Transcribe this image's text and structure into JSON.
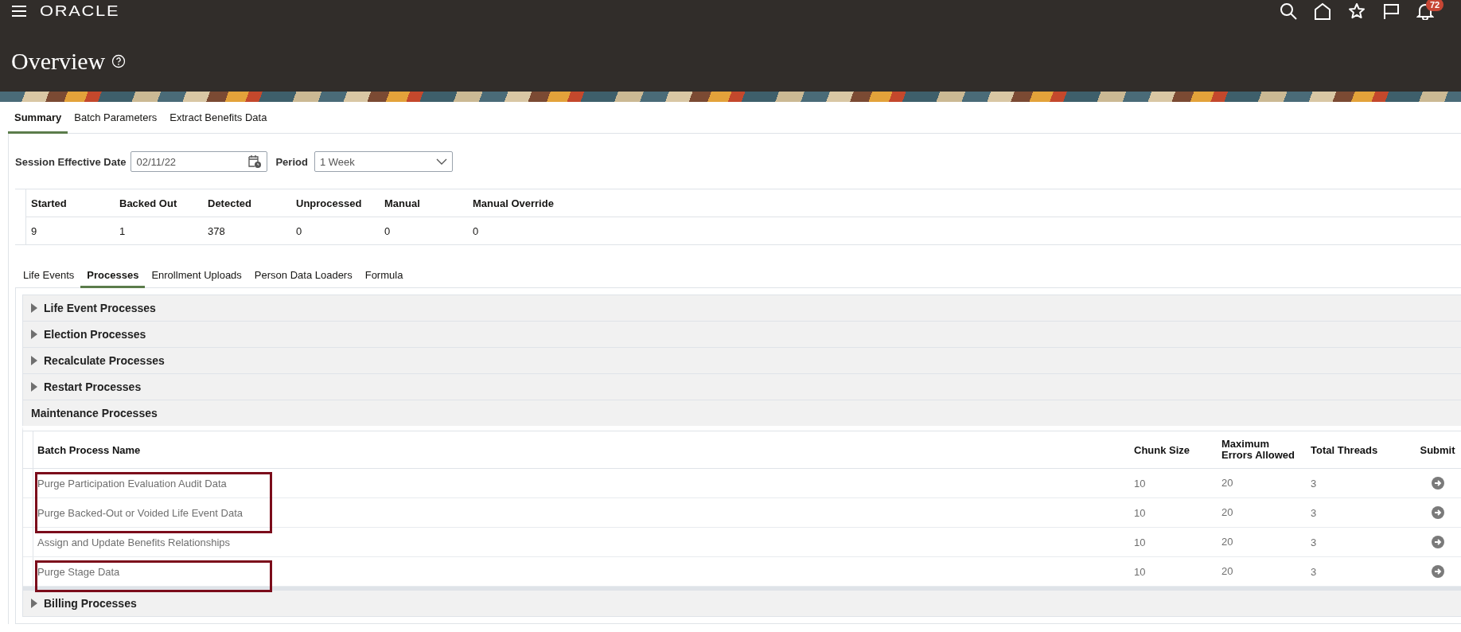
{
  "header": {
    "logo": "ORACLE",
    "notification_count": "72",
    "title": "Overview"
  },
  "tabs": [
    {
      "label": "Summary",
      "selected": true
    },
    {
      "label": "Batch Parameters",
      "selected": false
    },
    {
      "label": "Extract Benefits Data",
      "selected": false
    }
  ],
  "session": {
    "date_label": "Session Effective Date",
    "date_value": "02/11/22",
    "period_label": "Period",
    "period_value": "1 Week"
  },
  "summary": {
    "columns": [
      "Started",
      "Backed Out",
      "Detected",
      "Unprocessed",
      "Manual",
      "Manual Override"
    ],
    "values": [
      "9",
      "1",
      "378",
      "0",
      "0",
      "0"
    ]
  },
  "sub_tabs": [
    {
      "label": "Life Events",
      "selected": false
    },
    {
      "label": "Processes",
      "selected": true
    },
    {
      "label": "Enrollment Uploads",
      "selected": false
    },
    {
      "label": "Person Data Loaders",
      "selected": false
    },
    {
      "label": "Formula",
      "selected": false
    }
  ],
  "process_groups": [
    {
      "title": "Life Event Processes",
      "expanded": false
    },
    {
      "title": "Election Processes",
      "expanded": false
    },
    {
      "title": "Recalculate Processes",
      "expanded": false
    },
    {
      "title": "Restart Processes",
      "expanded": false
    },
    {
      "title": "Maintenance Processes",
      "expanded": true,
      "table": {
        "columns": [
          "Batch Process Name",
          "Chunk Size",
          "Maximum Errors Allowed",
          "Total Threads",
          "Submit"
        ],
        "rows": [
          {
            "name": "Purge Participation Evaluation Audit Data",
            "chunk_size": "10",
            "max_errors": "20",
            "total_threads": "3",
            "highlighted": true
          },
          {
            "name": "Purge Backed-Out or Voided Life Event Data",
            "chunk_size": "10",
            "max_errors": "20",
            "total_threads": "3",
            "highlighted": true
          },
          {
            "name": "Assign and Update Benefits Relationships",
            "chunk_size": "10",
            "max_errors": "20",
            "total_threads": "3",
            "highlighted": false
          },
          {
            "name": "Purge Stage Data",
            "chunk_size": "10",
            "max_errors": "20",
            "total_threads": "3",
            "highlighted": true
          }
        ]
      }
    },
    {
      "title": "Billing Processes",
      "expanded": false
    }
  ]
}
